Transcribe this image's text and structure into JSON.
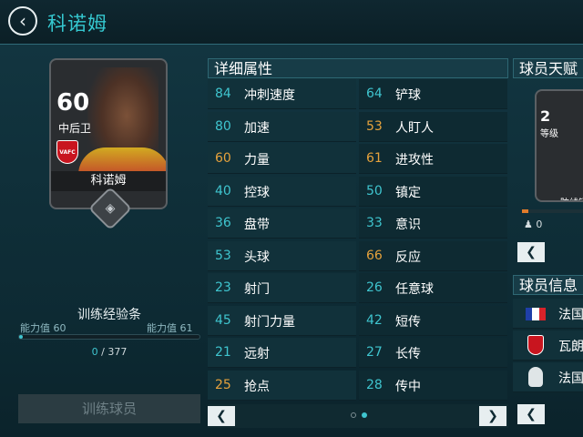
{
  "header": {
    "title": "科诺姆",
    "back_icon": "‹"
  },
  "card": {
    "rating": "60",
    "position": "中后卫",
    "name": "科诺姆",
    "club_badge": "VAFC"
  },
  "training": {
    "title": "训练经验条",
    "ability_left_label": "能力值",
    "ability_left_value": "60",
    "ability_right_label": "能力值",
    "ability_right_value": "61",
    "xp_current": "0",
    "xp_separator": "/",
    "xp_total": "377",
    "progress": 0,
    "button_label": "训练球员"
  },
  "attributes": {
    "title": "详细属性",
    "rows": [
      {
        "l_val": "84",
        "l_name": "冲刺速度",
        "l_color": "#3fc5cf",
        "r_val": "64",
        "r_name": "铲球",
        "r_color": "#3fc5cf"
      },
      {
        "l_val": "80",
        "l_name": "加速",
        "l_color": "#3fc5cf",
        "r_val": "53",
        "r_name": "人盯人",
        "r_color": "#e6a23c"
      },
      {
        "l_val": "60",
        "l_name": "力量",
        "l_color": "#e6a23c",
        "r_val": "61",
        "r_name": "进攻性",
        "r_color": "#e6a23c"
      },
      {
        "l_val": "40",
        "l_name": "控球",
        "l_color": "#3fc5cf",
        "r_val": "50",
        "r_name": "镇定",
        "r_color": "#3fc5cf"
      },
      {
        "l_val": "36",
        "l_name": "盘带",
        "l_color": "#3fc5cf",
        "r_val": "33",
        "r_name": "意识",
        "r_color": "#3fc5cf"
      },
      {
        "l_val": "53",
        "l_name": "头球",
        "l_color": "#3fc5cf",
        "r_val": "66",
        "r_name": "反应",
        "r_color": "#e6a23c"
      },
      {
        "l_val": "23",
        "l_name": "射门",
        "l_color": "#3fc5cf",
        "r_val": "26",
        "r_name": "任意球",
        "r_color": "#3fc5cf"
      },
      {
        "l_val": "45",
        "l_name": "射门力量",
        "l_color": "#3fc5cf",
        "r_val": "42",
        "r_name": "短传",
        "r_color": "#3fc5cf"
      },
      {
        "l_val": "21",
        "l_name": "远射",
        "l_color": "#3fc5cf",
        "r_val": "27",
        "r_name": "长传",
        "r_color": "#3fc5cf"
      },
      {
        "l_val": "25",
        "l_name": "抢点",
        "l_color": "#e6a23c",
        "r_val": "28",
        "r_name": "传中",
        "r_color": "#3fc5cf"
      }
    ],
    "prev_icon": "❮",
    "next_icon": "❯"
  },
  "talent": {
    "title": "球员天赋",
    "level": "2",
    "level_label": "等级",
    "role": "防线锁",
    "count": "0",
    "back_icon": "❮"
  },
  "info": {
    "title": "球员信息",
    "nation": "法国",
    "club": "瓦朗",
    "league": "法国",
    "back_icon": "❮"
  }
}
